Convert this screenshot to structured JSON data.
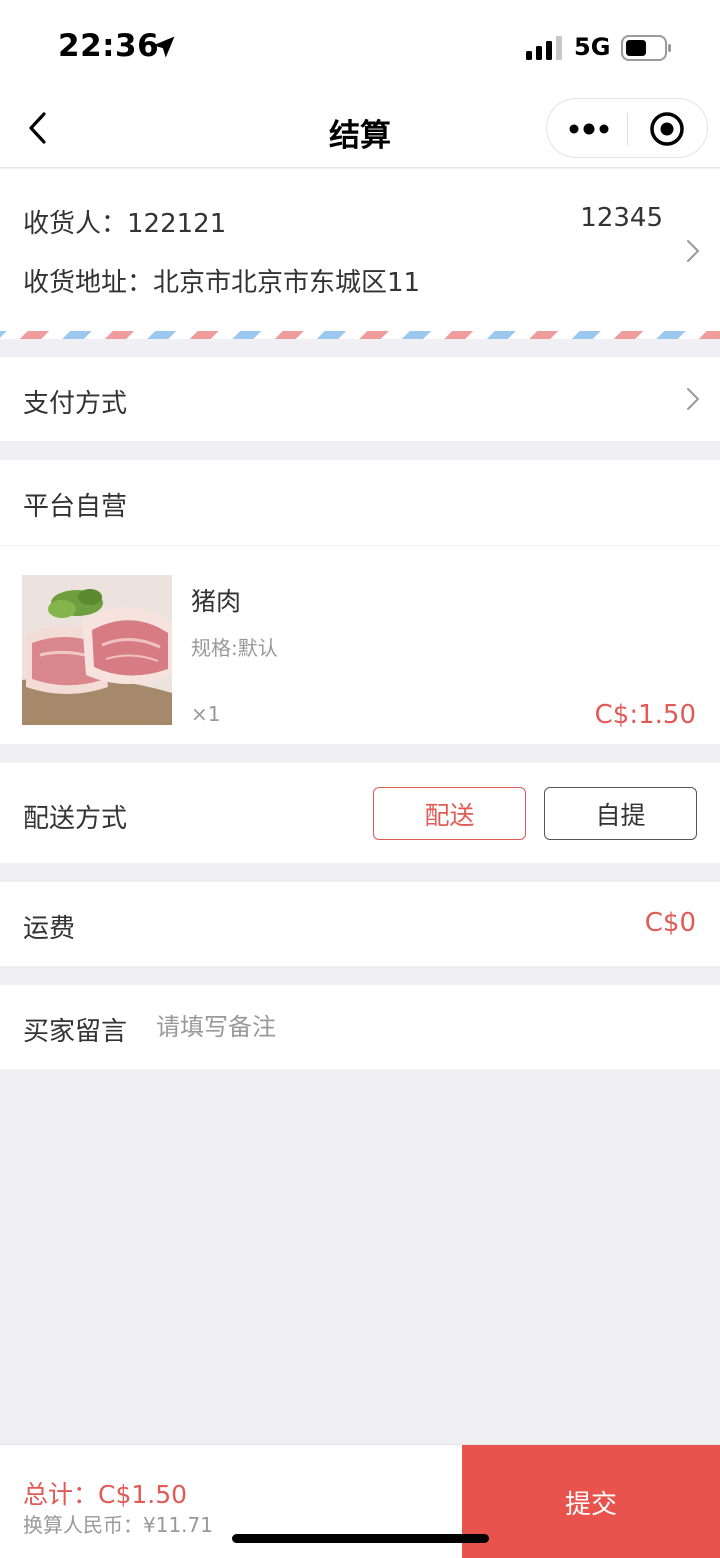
{
  "status_bar": {
    "time": "22:36",
    "network": "5G"
  },
  "nav": {
    "title": "结算"
  },
  "address": {
    "name_label": "收货人：",
    "name": "122121",
    "phone": "12345",
    "address_label": "收货地址：",
    "address": "北京市北京市东城区11"
  },
  "payment": {
    "label": "支付方式"
  },
  "store": {
    "name": "平台自营",
    "product": {
      "name": "猪肉",
      "spec": "规格:默认",
      "qty": "×1",
      "price": "C$:1.50"
    }
  },
  "delivery": {
    "label": "配送方式",
    "option_delivery": "配送",
    "option_pickup": "自提"
  },
  "freight": {
    "label": "运费",
    "value": "C$0"
  },
  "message": {
    "label": "买家留言",
    "placeholder": "请填写备注"
  },
  "bottom": {
    "total_label": "总计：",
    "total_value": "C$1.50",
    "rmb_label": "换算人民币：",
    "rmb_value": "¥11.71",
    "submit": "提交"
  },
  "colors": {
    "accent": "#e15a55",
    "submit_bg": "#e9534e",
    "page_bg": "#efeff4"
  },
  "icons": [
    "location-arrow-icon",
    "signal-icon",
    "battery-icon",
    "back-icon",
    "more-icon",
    "target-icon",
    "chevron-right-icon",
    "pork-image"
  ]
}
